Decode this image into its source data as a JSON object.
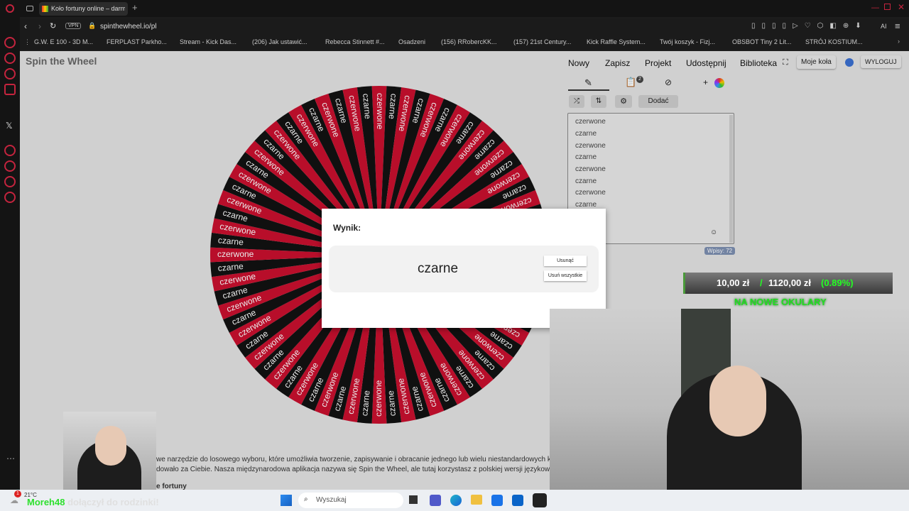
{
  "browser": {
    "tab_title": "Koło fortuny online – darmo",
    "url": "spinthewheel.io/pl",
    "vpn": "VPN",
    "bookmarks": [
      "G.W. E 100 - 3D M...",
      "FERPLAST Parkho...",
      "Stream - Kick Das...",
      "(206) Jak ustawić...",
      "Rebecca Stinnett #...",
      "Osadzeni",
      "(156) RRobercKK...",
      "(157) 21st Century...",
      "Kick Raffle System...",
      "Twój koszyk - Fizj...",
      "OBSBOT Tiny 2 Lit...",
      "STRÓJ KOSTIUM..."
    ],
    "ai": "AI"
  },
  "site": {
    "logo": "Spin the Wheel",
    "nav": {
      "new": "Nowy",
      "save": "Zapisz",
      "project": "Projekt",
      "share": "Udostępnij",
      "library": "Biblioteka",
      "my_wheels": "Moje koła",
      "logout": "WYLOGUJ"
    },
    "tools": {
      "results_badge": "2",
      "add": "Dodać"
    },
    "entries": [
      "czerwone",
      "czarne",
      "czerwone",
      "czarne",
      "czerwone",
      "czarne",
      "czerwone",
      "czarne"
    ],
    "entries_count": "Wpisy: 72",
    "wheel": {
      "segments": 72,
      "labels": [
        "czerwone",
        "czarne"
      ],
      "colors": [
        "#c8102e",
        "#121212"
      ]
    },
    "description_line1": "we narzędzie do losowego wyboru, które umożliwia tworzenie, zapisywanie i obracanie jednego lub wielu niestandardowych kół na jed",
    "description_line2": "dowało za Ciebie. Nasza międzynarodowa aplikacja nazywa się Spin the Wheel, ale tutaj korzystasz z polskiej wersji językowej, która o",
    "description_line3": "e fortuny"
  },
  "modal": {
    "title": "Wynik:",
    "result": "czarne",
    "remove": "Usunąć",
    "remove_all": "Usuń wszystkie"
  },
  "stream": {
    "donation": "10,00 zł",
    "goal": "1120,00 zł",
    "percent": "(0.89%)",
    "goal_title": "NA NOWE OKULARY",
    "progress": 0.0089,
    "follow_name": "Moreh48",
    "follow_text": "dołączył do rodzinki!"
  },
  "taskbar": {
    "temp": "21°C",
    "search": "Wyszukaj",
    "notif": "1"
  }
}
